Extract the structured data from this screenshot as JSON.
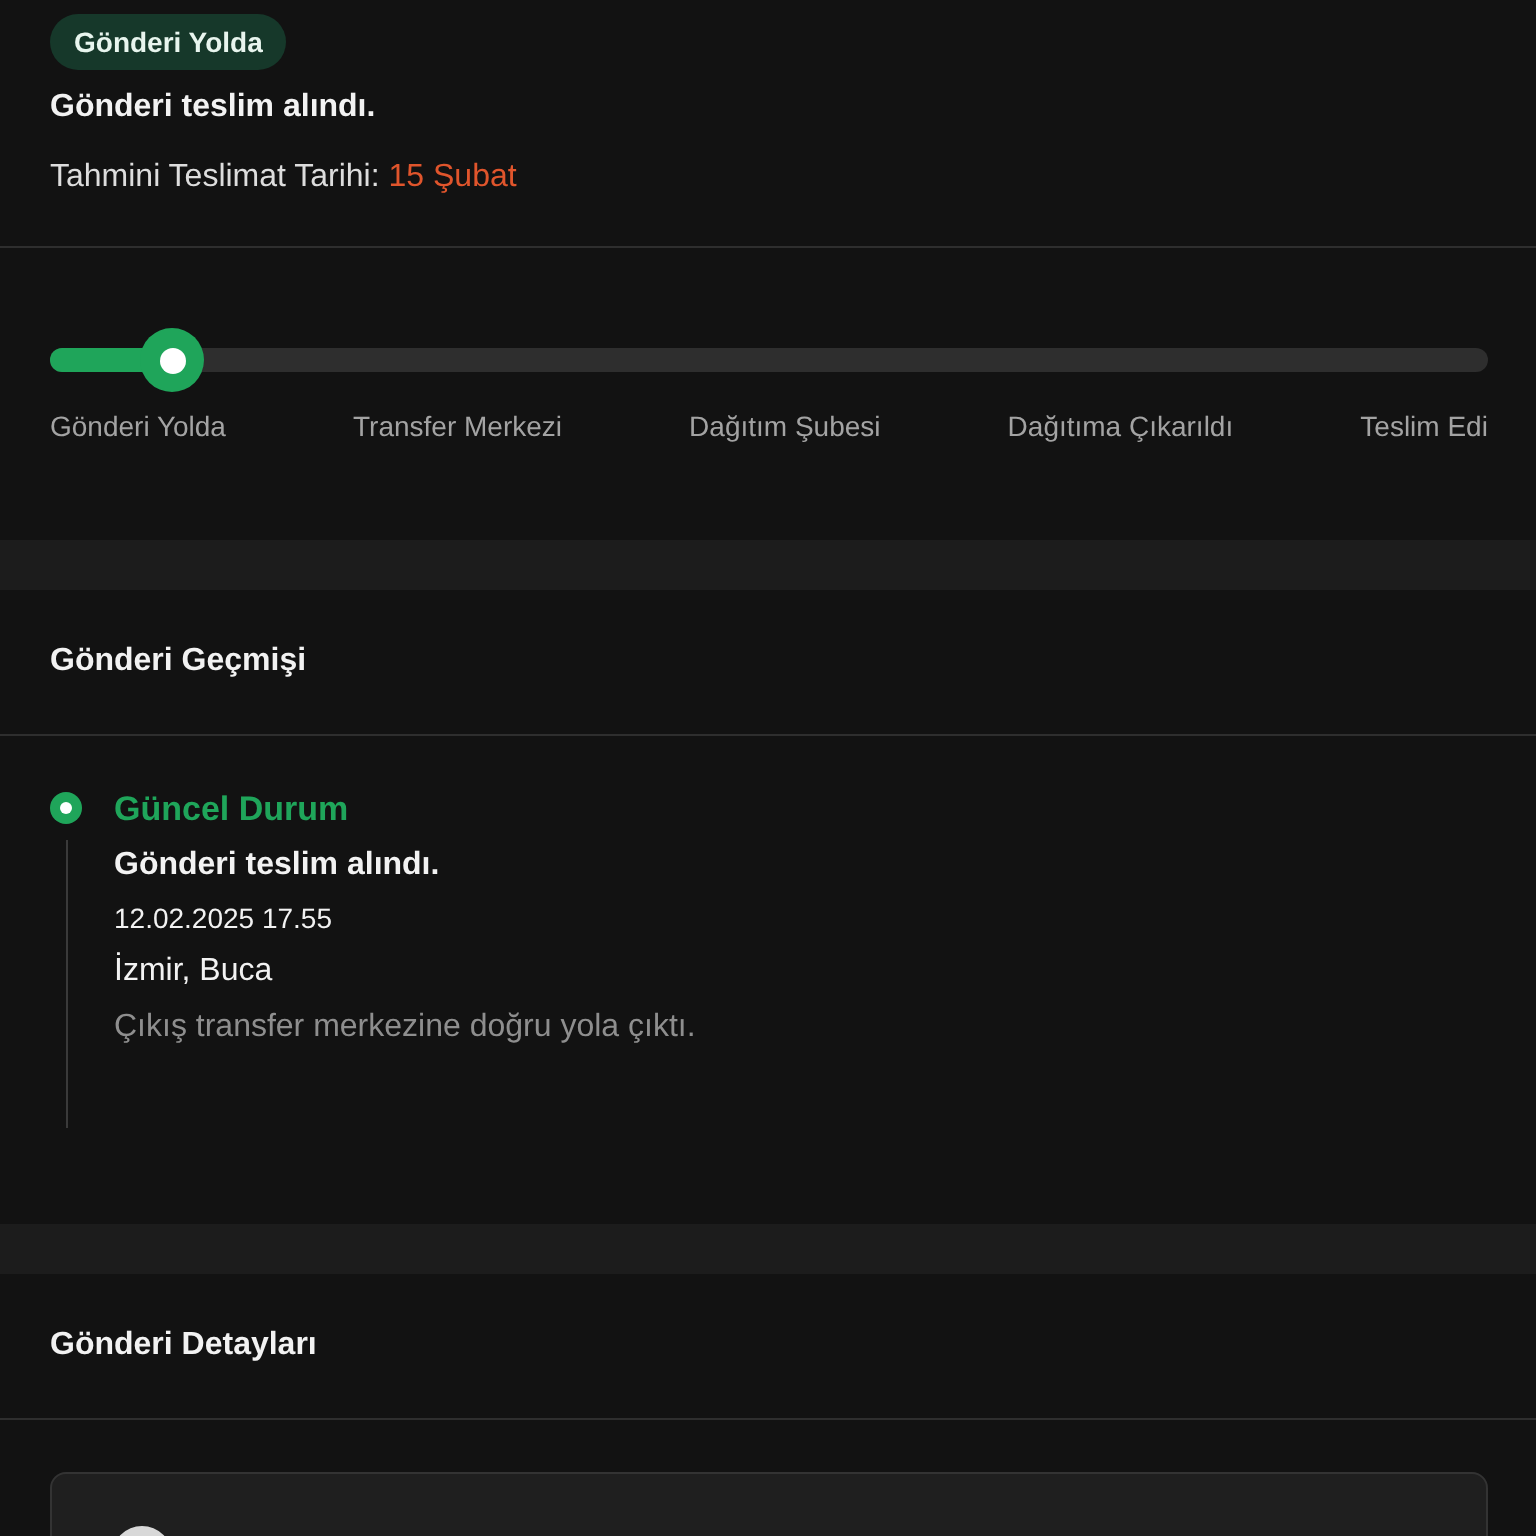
{
  "status": {
    "badge": "Gönderi Yolda",
    "message": "Gönderi teslim alındı.",
    "eta_label": "Tahmini Teslimat Tarihi:",
    "eta_value": "15 Şubat"
  },
  "progress": {
    "level": 0.085,
    "steps": [
      "Gönderi Yolda",
      "Transfer Merkezi",
      "Dağıtım Şubesi",
      "Dağıtıma Çıkarıldı",
      "Teslim Edi"
    ]
  },
  "history": {
    "title": "Gönderi Geçmişi",
    "events": [
      {
        "status": "Güncel Durum",
        "current": true,
        "title": "Gönderi teslim alındı.",
        "datetime": "12.02.2025 17.55",
        "location": "İzmir, Buca",
        "description": "Çıkış transfer merkezine doğru yola çıktı."
      }
    ]
  },
  "details": {
    "title": "Gönderi Detayları"
  }
}
